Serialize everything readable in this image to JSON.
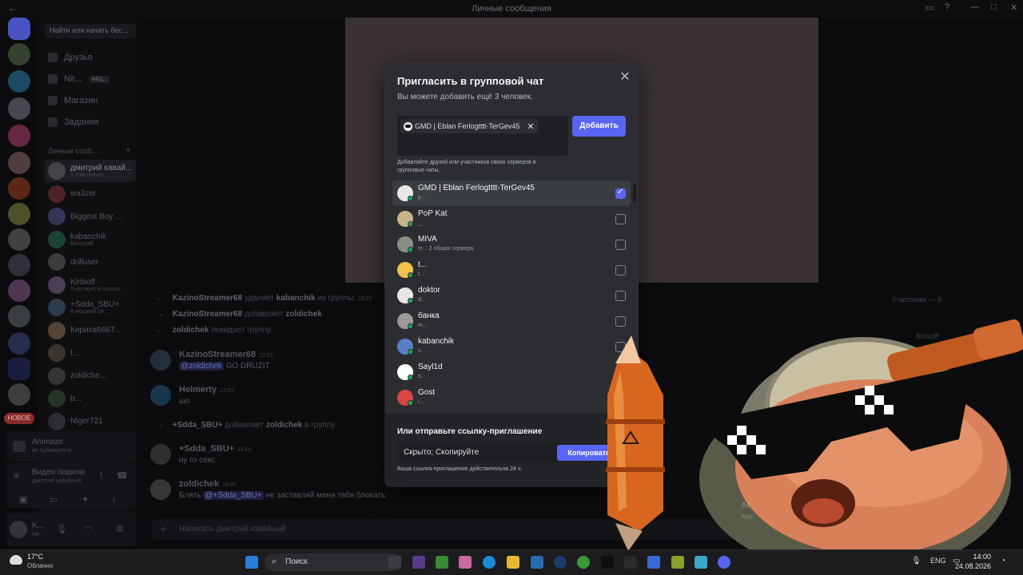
{
  "window": {
    "title": "Личные сообщения"
  },
  "sidebar": {
    "search_placeholder": "Найти или начать бес...",
    "nav": [
      {
        "label": "Друзья"
      },
      {
        "label": "Nit...",
        "badge": "АКЦ..."
      },
      {
        "label": "Магазин"
      },
      {
        "label": "Задания"
      }
    ],
    "dm_header": "Личные сооб...",
    "dms": [
      {
        "name": "дмитрий кавай...",
        "sub": "6 участников",
        "active": true
      },
      {
        "name": "wa3zer",
        "sub": ""
      },
      {
        "name": "Biggest Boy ...",
        "sub": ""
      },
      {
        "name": "kabanchik",
        "sub": "Minecraft"
      },
      {
        "name": "drilluser",
        "sub": ""
      },
      {
        "name": "Kirbioff",
        "sub": "Участвует в голосо..."
      },
      {
        "name": "+Sdda_SBU+",
        "sub": "В игровой си..."
      },
      {
        "name": "Кириха6667...",
        "sub": ""
      },
      {
        "name": "t...",
        "sub": ""
      },
      {
        "name": "zoldiche...",
        "sub": ""
      },
      {
        "name": "b...",
        "sub": ""
      },
      {
        "name": "Niger721",
        "sub": ""
      }
    ],
    "new_badge": "НОВОЕ",
    "activity": {
      "title": "Animaze",
      "sub": "не публикуется"
    },
    "voice": {
      "title": "Видео подклю",
      "sub": "дмитрий кавайный"
    },
    "user": {
      "name": "K...",
      "sub": "Не..."
    }
  },
  "chat": {
    "system_lines": [
      {
        "actor": "KazinoStreamer68",
        "text": "удаляет",
        "target": "kabanchik",
        "tail": "из группы.",
        "time": "13:57"
      },
      {
        "actor": "KazinoStreamer68",
        "text": "добавляет",
        "target": "zoldichek",
        "tail": "",
        "time": ""
      },
      {
        "actor": "zoldichek",
        "text": "покидает группу.",
        "target": "",
        "tail": "",
        "time": ""
      }
    ],
    "messages": [
      {
        "author": "KazinoStreamer68",
        "time": "13:59",
        "mention": "@zoldichek",
        "text": "GO DRUZIT"
      },
      {
        "author": "Helmerty",
        "time": "13:59",
        "mention": "",
        "text": "шо"
      },
      {
        "author": "+Sdda_SBU+",
        "time": "14:00",
        "mention": "",
        "text": "ну го секс"
      },
      {
        "author": "zoldichek",
        "time": "14:00",
        "mention": "@+Sdda_SBU+",
        "text": "Блять",
        "tail": "не заставляй меня тебя блокать"
      }
    ],
    "join_line": {
      "actor": "+Sdda_SBU+",
      "text": "добавляет",
      "target": "zoldichek",
      "tail": "в группу"
    },
    "composer_placeholder": "Написать дмитрий кавайный",
    "members_header": "Участники — 6",
    "members": [
      "Kirbioff"
    ]
  },
  "modal": {
    "title": "Пригласить в групповой чат",
    "subtitle": "Вы можете добавить ещё 3 человек.",
    "chip_label": "GMD | Eblan Ferlogtttt-TerGev45",
    "add_button": "Добавить",
    "hint": "Добавляйте друзей или участников своих серверов в групповые чаты.",
    "friends": [
      {
        "name": "GMD | Eblan Ferlogtttt-TerGev45",
        "sub": "p...",
        "checked": true,
        "color": "#e8e8e8"
      },
      {
        "name": "PoP Kat",
        "sub": "_...",
        "checked": false,
        "color": "#c8b48a"
      },
      {
        "name": "MIVA",
        "sub": "m...",
        "extra": "2 общих сервера",
        "checked": false,
        "color": "#8a8f86"
      },
      {
        "name": "t...",
        "sub": "t...",
        "checked": false,
        "color": "#f0c24a"
      },
      {
        "name": "doktor",
        "sub": "d...",
        "checked": false,
        "color": "#e6e6e6"
      },
      {
        "name": "банка",
        "sub": "m...",
        "checked": false,
        "color": "#9a9a9a"
      },
      {
        "name": "kabanchik",
        "sub": "s...",
        "checked": false,
        "color": "#5a7fc8"
      },
      {
        "name": "Sayl1d",
        "sub": "s...",
        "checked": false,
        "color": "#ffffff"
      },
      {
        "name": "Gost",
        "sub": "i...",
        "checked": false,
        "color": "#d94545"
      }
    ],
    "link_title": "Или отправьте ссылку-приглашение",
    "link_value": "Скрыто; Скопируйте",
    "copy_button": "Копировать",
    "link_hint": "Ваша ссылка-приглашение действительна 24 ч."
  },
  "overlay": {
    "caption": "Ак",
    "caption2": "Чтс"
  },
  "taskbar": {
    "weather_temp": "17°C",
    "weather_desc": "Облачно",
    "search_label": "Поиск",
    "lang": "ENG",
    "time": "14:00",
    "date": "24.08.2026"
  },
  "colors": {
    "accent": "#5865f2",
    "modal_bg": "#2b2d31",
    "online": "#23a55a",
    "danger": "#d83c3e"
  }
}
